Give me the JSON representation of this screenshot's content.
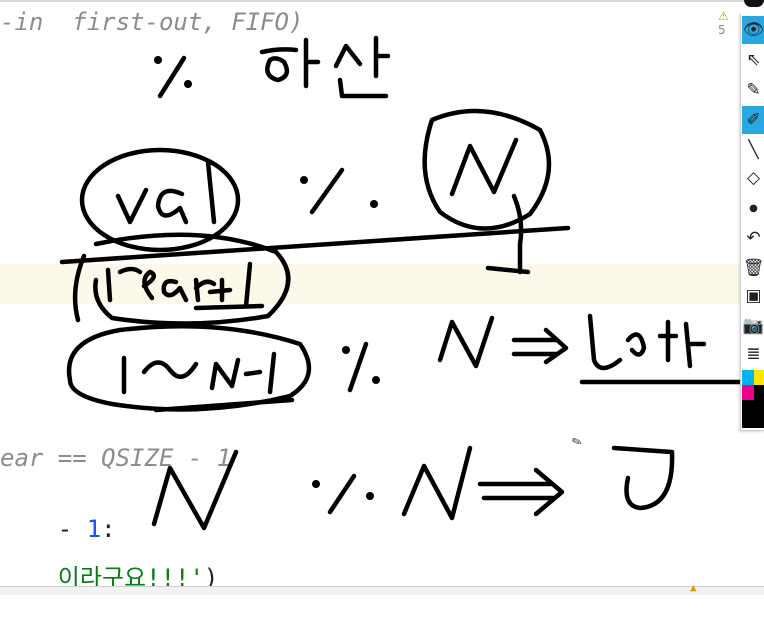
{
  "editor": {
    "code_lines": {
      "line1": "-in  first-out, FIFO)",
      "line2": "ear == QSIZE - 1",
      "line3_prefix": "- ",
      "line3_num": "1",
      "line3_suffix": ":",
      "line4_str": "이라구요!!!'",
      "line4_suffix": ")"
    },
    "warning_count": "5"
  },
  "annotation": {
    "text_items": [
      "% 연산",
      "val",
      "%",
      "N",
      "(rear+1)",
      "1~N-1",
      "% N ⇒",
      "그대로",
      "N % N ⇒ 0"
    ],
    "ink_color": "#000000"
  },
  "toolbar": {
    "tools": [
      {
        "icon": "eye-icon",
        "glyph": "👁",
        "active": true
      },
      {
        "icon": "pointer-icon",
        "glyph": "⇖",
        "active": false
      },
      {
        "icon": "pen-icon",
        "glyph": "✎",
        "active": false
      },
      {
        "icon": "highlighter-icon",
        "glyph": "✐",
        "active": true
      },
      {
        "icon": "line-icon",
        "glyph": "╲",
        "active": false
      },
      {
        "icon": "eraser-icon",
        "glyph": "◇",
        "active": false
      },
      {
        "icon": "dot-size-icon",
        "glyph": "●",
        "active": false
      },
      {
        "icon": "undo-icon",
        "glyph": "↶",
        "active": false
      },
      {
        "icon": "trash-icon",
        "glyph": "🗑",
        "active": false
      },
      {
        "icon": "board-icon",
        "glyph": "▣",
        "active": false
      },
      {
        "icon": "camera-icon",
        "glyph": "📷",
        "active": false
      },
      {
        "icon": "notes-icon",
        "glyph": "≣",
        "active": false
      }
    ],
    "active_color": "#29a8e0",
    "palette": [
      "#00b4f0",
      "#ffe600",
      "#ec008c",
      "#000000"
    ]
  }
}
